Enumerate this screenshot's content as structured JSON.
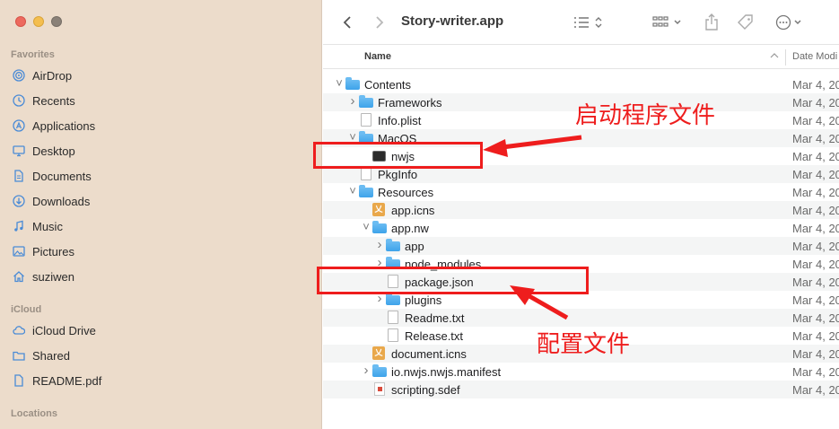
{
  "window": {
    "title": "Story-writer.app"
  },
  "sidebar": {
    "favorites_title": "Favorites",
    "favorites": [
      {
        "label": "AirDrop",
        "icon": "airdrop-icon"
      },
      {
        "label": "Recents",
        "icon": "clock-icon"
      },
      {
        "label": "Applications",
        "icon": "applications-icon"
      },
      {
        "label": "Desktop",
        "icon": "desktop-icon"
      },
      {
        "label": "Documents",
        "icon": "document-icon"
      },
      {
        "label": "Downloads",
        "icon": "download-icon"
      },
      {
        "label": "Music",
        "icon": "music-icon"
      },
      {
        "label": "Pictures",
        "icon": "pictures-icon"
      },
      {
        "label": "suziwen",
        "icon": "home-icon"
      }
    ],
    "icloud_title": "iCloud",
    "icloud": [
      {
        "label": "iCloud Drive",
        "icon": "cloud-icon"
      },
      {
        "label": "Shared",
        "icon": "shared-folder-icon"
      },
      {
        "label": "README.pdf",
        "icon": "document-icon"
      }
    ],
    "locations_title": "Locations"
  },
  "columns": {
    "name": "Name",
    "date": "Date Modi"
  },
  "files": [
    {
      "name": "Contents",
      "type": "folder",
      "level": 0,
      "chevron": "down",
      "date": "Mar 4, 20"
    },
    {
      "name": "Frameworks",
      "type": "folder",
      "level": 1,
      "chevron": "right",
      "date": "Mar 4, 20"
    },
    {
      "name": "Info.plist",
      "type": "doc",
      "level": 1,
      "chevron": "",
      "date": "Mar 4, 20"
    },
    {
      "name": "MacOS",
      "type": "folder",
      "level": 1,
      "chevron": "down",
      "date": "Mar 4, 20"
    },
    {
      "name": "nwjs",
      "type": "terminal",
      "level": 2,
      "chevron": "",
      "date": "Mar 4, 20"
    },
    {
      "name": "PkgInfo",
      "type": "doc",
      "level": 1,
      "chevron": "",
      "date": "Mar 4, 20"
    },
    {
      "name": "Resources",
      "type": "folder",
      "level": 1,
      "chevron": "down",
      "date": "Mar 4, 20"
    },
    {
      "name": "app.icns",
      "type": "icns",
      "level": 2,
      "chevron": "",
      "date": "Mar 4, 20"
    },
    {
      "name": "app.nw",
      "type": "folder",
      "level": 2,
      "chevron": "down",
      "date": "Mar 4, 20"
    },
    {
      "name": "app",
      "type": "folder",
      "level": 3,
      "chevron": "right",
      "date": "Mar 4, 20"
    },
    {
      "name": "node_modules",
      "type": "folder",
      "level": 3,
      "chevron": "right",
      "date": "Mar 4, 20"
    },
    {
      "name": "package.json",
      "type": "doc",
      "level": 3,
      "chevron": "",
      "date": "Mar 4, 20"
    },
    {
      "name": "plugins",
      "type": "folder",
      "level": 3,
      "chevron": "right",
      "date": "Mar 4, 20"
    },
    {
      "name": "Readme.txt",
      "type": "doc",
      "level": 3,
      "chevron": "",
      "date": "Mar 4, 20"
    },
    {
      "name": "Release.txt",
      "type": "doc",
      "level": 3,
      "chevron": "",
      "date": "Mar 4, 20"
    },
    {
      "name": "document.icns",
      "type": "icns",
      "level": 2,
      "chevron": "",
      "date": "Mar 4, 20"
    },
    {
      "name": "io.nwjs.nwjs.manifest",
      "type": "folder",
      "level": 2,
      "chevron": "right",
      "date": "Mar 4, 20"
    },
    {
      "name": "scripting.sdef",
      "type": "sdef",
      "level": 2,
      "chevron": "",
      "date": "Mar 4, 20"
    }
  ],
  "annotations": {
    "launcher": "启动程序文件",
    "config": "配置文件",
    "color": "#ee1d1d"
  }
}
